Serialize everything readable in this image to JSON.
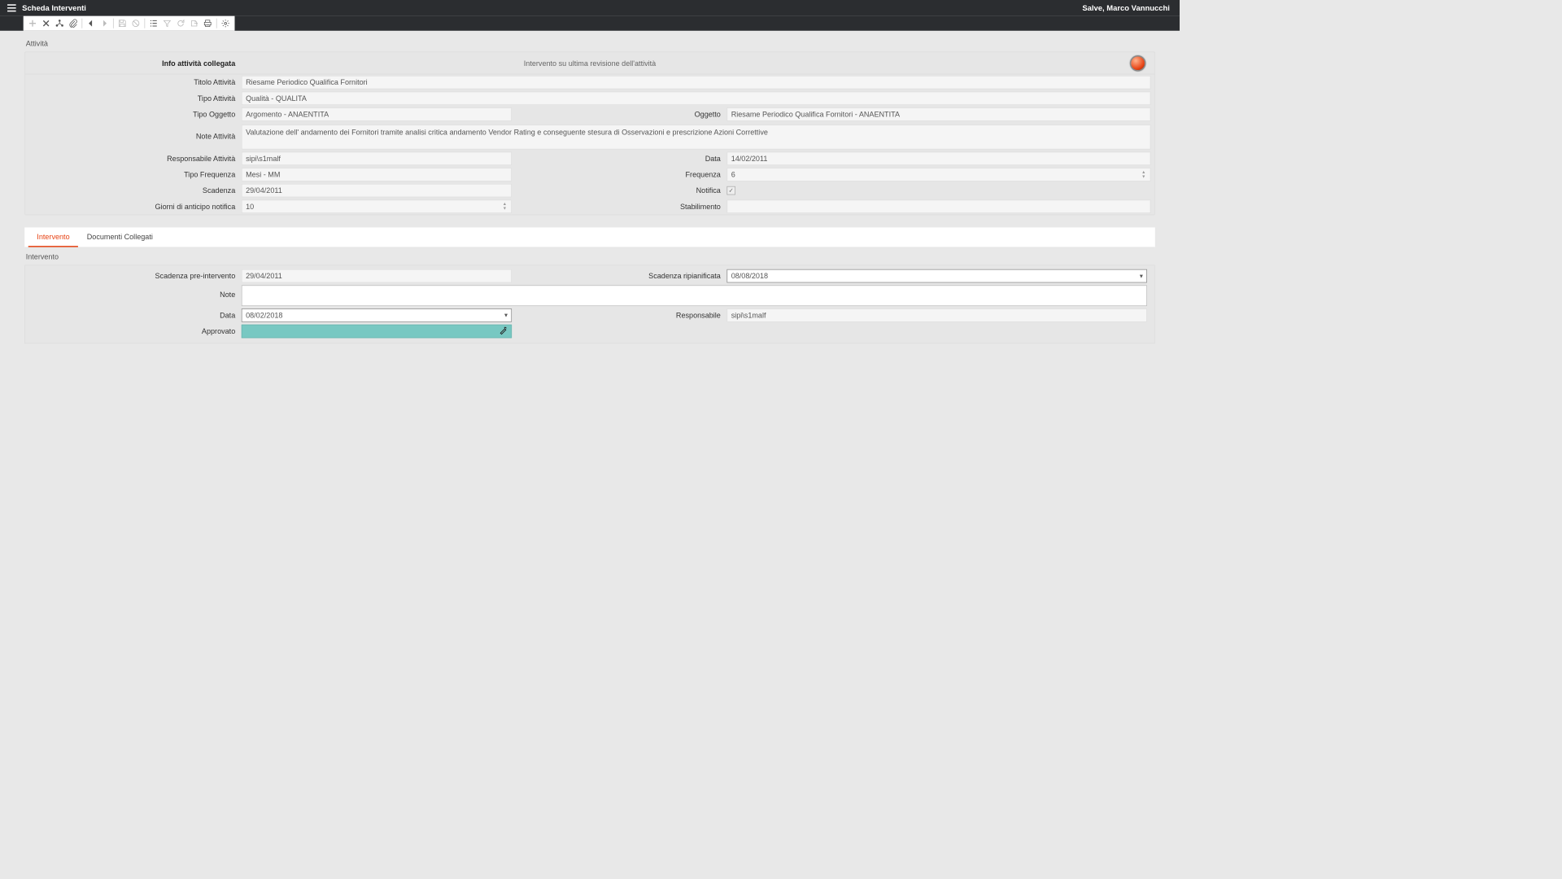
{
  "header": {
    "title": "Scheda Interventi",
    "user_greeting": "Salve, Marco Vannucchi"
  },
  "toolbar": {
    "icons": [
      "plus-icon",
      "close-icon",
      "tree-icon",
      "attach-icon",
      "back-icon",
      "forward-icon",
      "save-icon",
      "cancel-round-icon",
      "list-icon",
      "filter-icon",
      "refresh-icon",
      "export-icon",
      "print-icon",
      "gear-icon"
    ]
  },
  "section_activity": {
    "title": "Attività",
    "info_label": "Info attività collegata",
    "info_center_text": "Intervento su ultima revisione dell'attività",
    "fields": {
      "titolo_label": "Titolo Attività",
      "titolo_value": "Riesame Periodico Qualifica Fornitori",
      "tipo_attivita_label": "Tipo Attività",
      "tipo_attivita_value": "Qualità - QUALITA",
      "tipo_oggetto_label": "Tipo Oggetto",
      "tipo_oggetto_value": "Argomento - ANAENTITA",
      "oggetto_label": "Oggetto",
      "oggetto_value": "Riesame Periodico Qualifica Fornitori - ANAENTITA",
      "note_label": "Note Attività",
      "note_value": "Valutazione dell' andamento dei Fornitori tramite analisi critica andamento Vendor Rating e conseguente stesura di Osservazioni e prescrizione Azioni Correttive",
      "responsabile_label": "Responsabile Attività",
      "responsabile_value": "sipi\\s1malf",
      "data_label": "Data",
      "data_value": "14/02/2011",
      "tipo_frequenza_label": "Tipo Frequenza",
      "tipo_frequenza_value": "Mesi - MM",
      "frequenza_label": "Frequenza",
      "frequenza_value": "6",
      "scadenza_label": "Scadenza",
      "scadenza_value": "29/04/2011",
      "notifica_label": "Notifica",
      "giorni_anticipo_label": "Giorni di anticipo notifica",
      "giorni_anticipo_value": "10",
      "stabilimento_label": "Stabilimento",
      "stabilimento_value": ""
    }
  },
  "tabs": {
    "intervento": "Intervento",
    "documenti": "Documenti Collegati"
  },
  "section_intervento": {
    "title": "Intervento",
    "fields": {
      "scadenza_pre_label": "Scadenza pre-intervento",
      "scadenza_pre_value": "29/04/2011",
      "scadenza_ripian_label": "Scadenza ripianificata",
      "scadenza_ripian_value": "08/08/2018",
      "note_label": "Note",
      "note_value": "",
      "data_label": "Data",
      "data_value": "08/02/2018",
      "responsabile_label": "Responsabile",
      "responsabile_value": "sipi\\s1malf",
      "approvato_label": "Approvato"
    }
  }
}
